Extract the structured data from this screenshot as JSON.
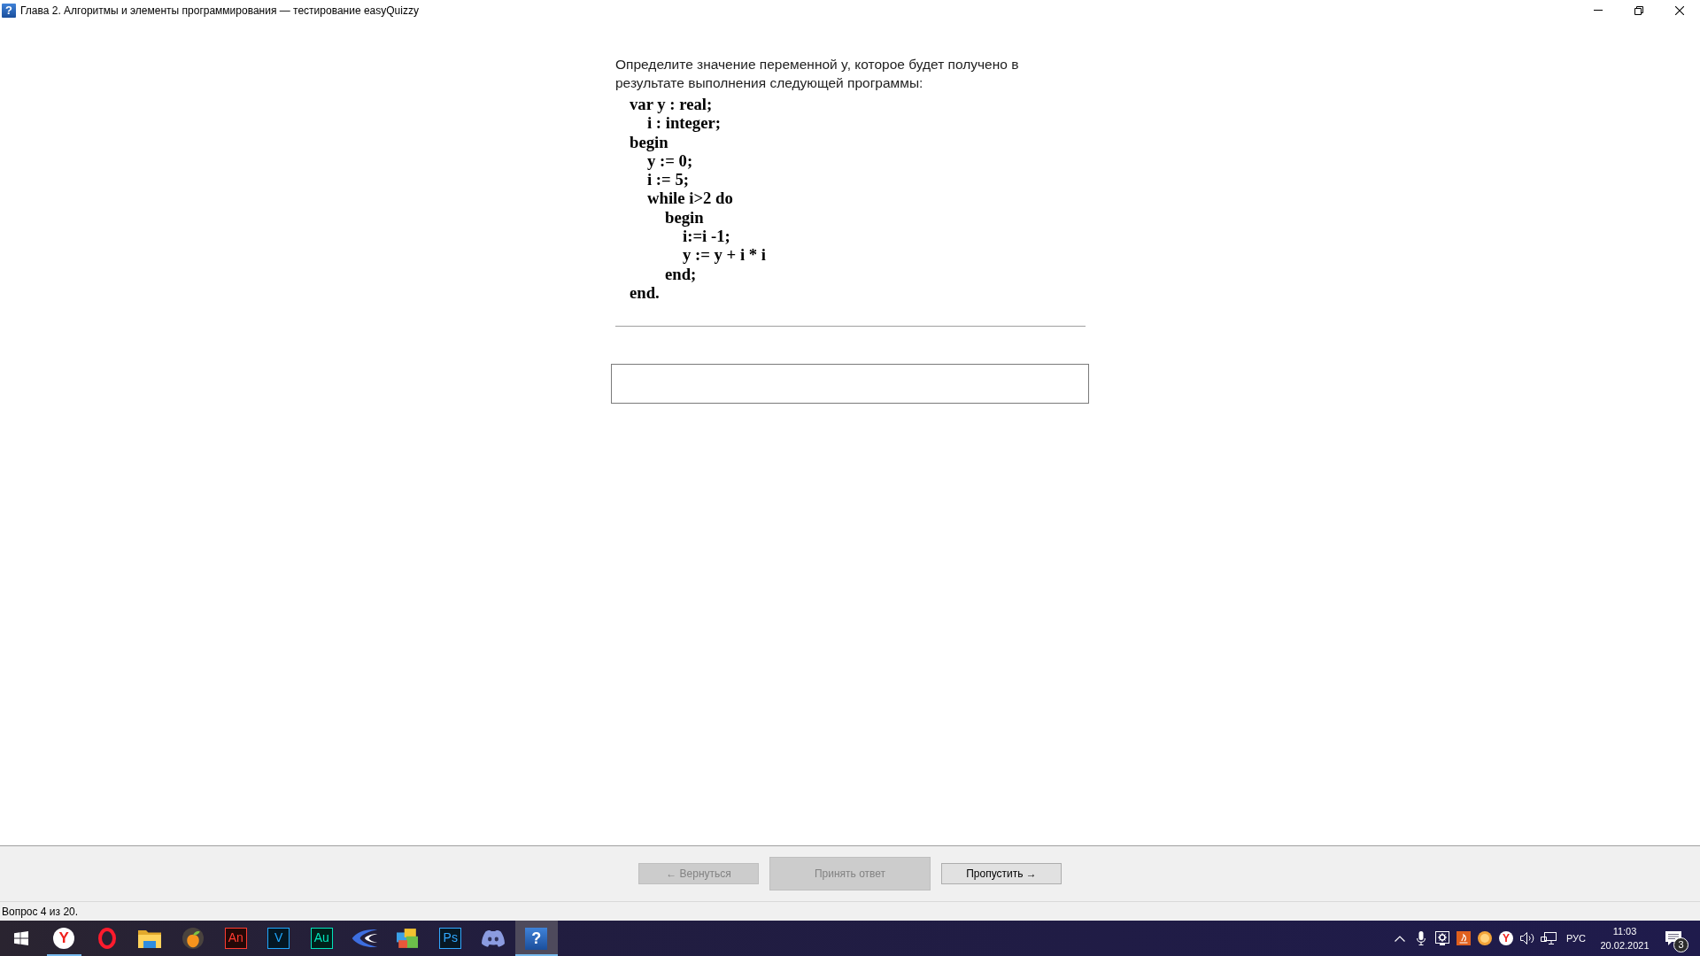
{
  "window": {
    "icon_glyph": "?",
    "title": "Глава 2. Алгоритмы и элементы программирования — тестирование easyQuizzy"
  },
  "question": {
    "prompt": "Определите значение переменной y, которое будет получено в результате выполнения следующей программы:",
    "code": [
      {
        "text": "var y : real;",
        "children": [
          {
            "text": "i : integer;"
          }
        ]
      },
      {
        "text": "begin",
        "children": [
          {
            "text": "y := 0;"
          },
          {
            "text": "i := 5;"
          },
          {
            "text": "while i>2 do",
            "children": [
              {
                "text": "begin",
                "children": [
                  {
                    "text": "i:=i -1;"
                  },
                  {
                    "text": "y := y + i * i"
                  }
                ]
              },
              {
                "text": "end;"
              }
            ]
          }
        ]
      },
      {
        "text": "end."
      }
    ]
  },
  "buttons": [
    {
      "label": "← Вернуться",
      "kind": "nav",
      "disabled": true
    },
    {
      "label": "Принять ответ",
      "kind": "main",
      "disabled": true
    },
    {
      "label": "Пропустить →",
      "kind": "nav",
      "disabled": false
    }
  ],
  "status_bar": {
    "text": "Вопрос 4 из 20."
  },
  "taskbar": {
    "apps": [
      {
        "kind": "disc",
        "label": "Y",
        "running": true,
        "selected": false
      },
      {
        "kind": "ring",
        "running": false,
        "selected": false
      },
      {
        "kind": "folder",
        "running": false,
        "selected": false
      },
      {
        "kind": "fruit",
        "running": false,
        "selected": false
      },
      {
        "kind": "tile",
        "label": "An",
        "color": "#ff3b30",
        "running": false,
        "selected": false
      },
      {
        "kind": "tile",
        "label": "V",
        "color": "#1ea7fd",
        "running": false,
        "selected": false
      },
      {
        "kind": "tile",
        "label": "Au",
        "color": "#00e4bb",
        "running": false,
        "selected": false
      },
      {
        "kind": "swoosh",
        "running": false,
        "selected": false
      },
      {
        "kind": "gallery",
        "running": false,
        "selected": false
      },
      {
        "kind": "tile",
        "label": "Ps",
        "color": "#31a8ff",
        "running": false,
        "selected": false
      },
      {
        "kind": "gamepad",
        "running": false,
        "selected": false
      },
      {
        "kind": "square",
        "label": "?",
        "running": true,
        "selected": true
      }
    ],
    "tray": {
      "browser_glyph": "Y",
      "language": "РУС",
      "time": "11:03",
      "date": "20.02.2021",
      "notification_count": "3"
    }
  }
}
